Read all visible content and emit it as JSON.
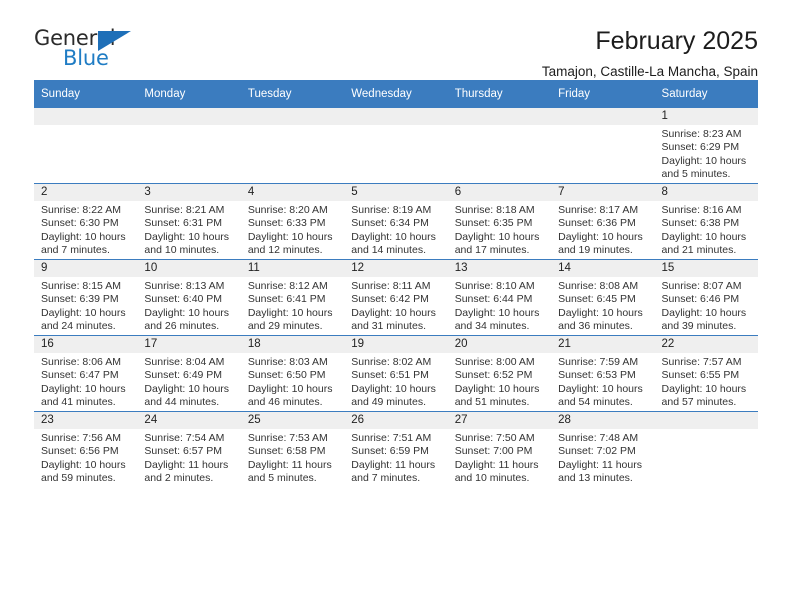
{
  "brand": {
    "name_part1": "General",
    "name_part2": "Blue",
    "flag_icon": "triangle-flag-icon",
    "flag_color": "#1e6fb8"
  },
  "header": {
    "month_title": "February 2025",
    "location": "Tamajon, Castille-La Mancha, Spain"
  },
  "theme": {
    "header_blue": "#3b7cbf",
    "daynum_band": "#efefef",
    "text": "#222222",
    "brand_blue": "#1f7cc4"
  },
  "calendar": {
    "weekday_headers": [
      "Sunday",
      "Monday",
      "Tuesday",
      "Wednesday",
      "Thursday",
      "Friday",
      "Saturday"
    ],
    "weeks": [
      [
        {
          "day": "",
          "sunrise": "",
          "sunset": "",
          "daylight_line1": "",
          "daylight_line2": ""
        },
        {
          "day": "",
          "sunrise": "",
          "sunset": "",
          "daylight_line1": "",
          "daylight_line2": ""
        },
        {
          "day": "",
          "sunrise": "",
          "sunset": "",
          "daylight_line1": "",
          "daylight_line2": ""
        },
        {
          "day": "",
          "sunrise": "",
          "sunset": "",
          "daylight_line1": "",
          "daylight_line2": ""
        },
        {
          "day": "",
          "sunrise": "",
          "sunset": "",
          "daylight_line1": "",
          "daylight_line2": ""
        },
        {
          "day": "",
          "sunrise": "",
          "sunset": "",
          "daylight_line1": "",
          "daylight_line2": ""
        },
        {
          "day": "1",
          "sunrise": "Sunrise: 8:23 AM",
          "sunset": "Sunset: 6:29 PM",
          "daylight_line1": "Daylight: 10 hours",
          "daylight_line2": "and 5 minutes."
        }
      ],
      [
        {
          "day": "2",
          "sunrise": "Sunrise: 8:22 AM",
          "sunset": "Sunset: 6:30 PM",
          "daylight_line1": "Daylight: 10 hours",
          "daylight_line2": "and 7 minutes."
        },
        {
          "day": "3",
          "sunrise": "Sunrise: 8:21 AM",
          "sunset": "Sunset: 6:31 PM",
          "daylight_line1": "Daylight: 10 hours",
          "daylight_line2": "and 10 minutes."
        },
        {
          "day": "4",
          "sunrise": "Sunrise: 8:20 AM",
          "sunset": "Sunset: 6:33 PM",
          "daylight_line1": "Daylight: 10 hours",
          "daylight_line2": "and 12 minutes."
        },
        {
          "day": "5",
          "sunrise": "Sunrise: 8:19 AM",
          "sunset": "Sunset: 6:34 PM",
          "daylight_line1": "Daylight: 10 hours",
          "daylight_line2": "and 14 minutes."
        },
        {
          "day": "6",
          "sunrise": "Sunrise: 8:18 AM",
          "sunset": "Sunset: 6:35 PM",
          "daylight_line1": "Daylight: 10 hours",
          "daylight_line2": "and 17 minutes."
        },
        {
          "day": "7",
          "sunrise": "Sunrise: 8:17 AM",
          "sunset": "Sunset: 6:36 PM",
          "daylight_line1": "Daylight: 10 hours",
          "daylight_line2": "and 19 minutes."
        },
        {
          "day": "8",
          "sunrise": "Sunrise: 8:16 AM",
          "sunset": "Sunset: 6:38 PM",
          "daylight_line1": "Daylight: 10 hours",
          "daylight_line2": "and 21 minutes."
        }
      ],
      [
        {
          "day": "9",
          "sunrise": "Sunrise: 8:15 AM",
          "sunset": "Sunset: 6:39 PM",
          "daylight_line1": "Daylight: 10 hours",
          "daylight_line2": "and 24 minutes."
        },
        {
          "day": "10",
          "sunrise": "Sunrise: 8:13 AM",
          "sunset": "Sunset: 6:40 PM",
          "daylight_line1": "Daylight: 10 hours",
          "daylight_line2": "and 26 minutes."
        },
        {
          "day": "11",
          "sunrise": "Sunrise: 8:12 AM",
          "sunset": "Sunset: 6:41 PM",
          "daylight_line1": "Daylight: 10 hours",
          "daylight_line2": "and 29 minutes."
        },
        {
          "day": "12",
          "sunrise": "Sunrise: 8:11 AM",
          "sunset": "Sunset: 6:42 PM",
          "daylight_line1": "Daylight: 10 hours",
          "daylight_line2": "and 31 minutes."
        },
        {
          "day": "13",
          "sunrise": "Sunrise: 8:10 AM",
          "sunset": "Sunset: 6:44 PM",
          "daylight_line1": "Daylight: 10 hours",
          "daylight_line2": "and 34 minutes."
        },
        {
          "day": "14",
          "sunrise": "Sunrise: 8:08 AM",
          "sunset": "Sunset: 6:45 PM",
          "daylight_line1": "Daylight: 10 hours",
          "daylight_line2": "and 36 minutes."
        },
        {
          "day": "15",
          "sunrise": "Sunrise: 8:07 AM",
          "sunset": "Sunset: 6:46 PM",
          "daylight_line1": "Daylight: 10 hours",
          "daylight_line2": "and 39 minutes."
        }
      ],
      [
        {
          "day": "16",
          "sunrise": "Sunrise: 8:06 AM",
          "sunset": "Sunset: 6:47 PM",
          "daylight_line1": "Daylight: 10 hours",
          "daylight_line2": "and 41 minutes."
        },
        {
          "day": "17",
          "sunrise": "Sunrise: 8:04 AM",
          "sunset": "Sunset: 6:49 PM",
          "daylight_line1": "Daylight: 10 hours",
          "daylight_line2": "and 44 minutes."
        },
        {
          "day": "18",
          "sunrise": "Sunrise: 8:03 AM",
          "sunset": "Sunset: 6:50 PM",
          "daylight_line1": "Daylight: 10 hours",
          "daylight_line2": "and 46 minutes."
        },
        {
          "day": "19",
          "sunrise": "Sunrise: 8:02 AM",
          "sunset": "Sunset: 6:51 PM",
          "daylight_line1": "Daylight: 10 hours",
          "daylight_line2": "and 49 minutes."
        },
        {
          "day": "20",
          "sunrise": "Sunrise: 8:00 AM",
          "sunset": "Sunset: 6:52 PM",
          "daylight_line1": "Daylight: 10 hours",
          "daylight_line2": "and 51 minutes."
        },
        {
          "day": "21",
          "sunrise": "Sunrise: 7:59 AM",
          "sunset": "Sunset: 6:53 PM",
          "daylight_line1": "Daylight: 10 hours",
          "daylight_line2": "and 54 minutes."
        },
        {
          "day": "22",
          "sunrise": "Sunrise: 7:57 AM",
          "sunset": "Sunset: 6:55 PM",
          "daylight_line1": "Daylight: 10 hours",
          "daylight_line2": "and 57 minutes."
        }
      ],
      [
        {
          "day": "23",
          "sunrise": "Sunrise: 7:56 AM",
          "sunset": "Sunset: 6:56 PM",
          "daylight_line1": "Daylight: 10 hours",
          "daylight_line2": "and 59 minutes."
        },
        {
          "day": "24",
          "sunrise": "Sunrise: 7:54 AM",
          "sunset": "Sunset: 6:57 PM",
          "daylight_line1": "Daylight: 11 hours",
          "daylight_line2": "and 2 minutes."
        },
        {
          "day": "25",
          "sunrise": "Sunrise: 7:53 AM",
          "sunset": "Sunset: 6:58 PM",
          "daylight_line1": "Daylight: 11 hours",
          "daylight_line2": "and 5 minutes."
        },
        {
          "day": "26",
          "sunrise": "Sunrise: 7:51 AM",
          "sunset": "Sunset: 6:59 PM",
          "daylight_line1": "Daylight: 11 hours",
          "daylight_line2": "and 7 minutes."
        },
        {
          "day": "27",
          "sunrise": "Sunrise: 7:50 AM",
          "sunset": "Sunset: 7:00 PM",
          "daylight_line1": "Daylight: 11 hours",
          "daylight_line2": "and 10 minutes."
        },
        {
          "day": "28",
          "sunrise": "Sunrise: 7:48 AM",
          "sunset": "Sunset: 7:02 PM",
          "daylight_line1": "Daylight: 11 hours",
          "daylight_line2": "and 13 minutes."
        },
        {
          "day": "",
          "sunrise": "",
          "sunset": "",
          "daylight_line1": "",
          "daylight_line2": ""
        }
      ]
    ]
  }
}
